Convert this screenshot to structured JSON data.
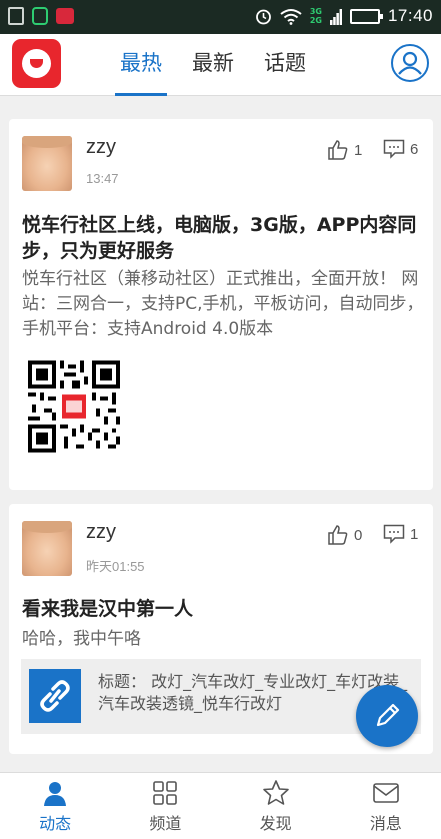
{
  "status_bar": {
    "time": "17:40",
    "network_top": "3G",
    "network_bottom": "2G"
  },
  "nav": {
    "tabs": [
      {
        "label": "最热"
      },
      {
        "label": "最新"
      },
      {
        "label": "话题"
      }
    ],
    "active_tab": "最热"
  },
  "posts": [
    {
      "author": "zzy",
      "time": "13:47",
      "likes": "1",
      "comments": "6",
      "title": "悦车行社区上线，电脑版，3G版，APP内容同步，只为更好服务",
      "body": "悦车行社区（兼移动社区）正式推出，全面开放！ 网站：三网合一，支持PC,手机，平板访问，自动同步，手机平台：支持Android 4.0版本",
      "image": "qr-code"
    },
    {
      "author": "zzy",
      "time": "昨天01:55",
      "likes": "0",
      "comments": "1",
      "title": "看来我是汉中第一人",
      "body": "哈哈，我中午咯",
      "link": {
        "text": "标题： 改灯_汽车改灯_专业改灯_车灯改装_汽车改装透镜_悦车行改灯"
      }
    }
  ],
  "bottom_nav": [
    {
      "label": "动态",
      "icon": "person-icon"
    },
    {
      "label": "频道",
      "icon": "grid-icon"
    },
    {
      "label": "发现",
      "icon": "star-icon"
    },
    {
      "label": "消息",
      "icon": "mail-icon"
    }
  ],
  "colors": {
    "accent": "#1a73c8",
    "brand": "#e8262d",
    "status_bar": "#1b2a23"
  }
}
